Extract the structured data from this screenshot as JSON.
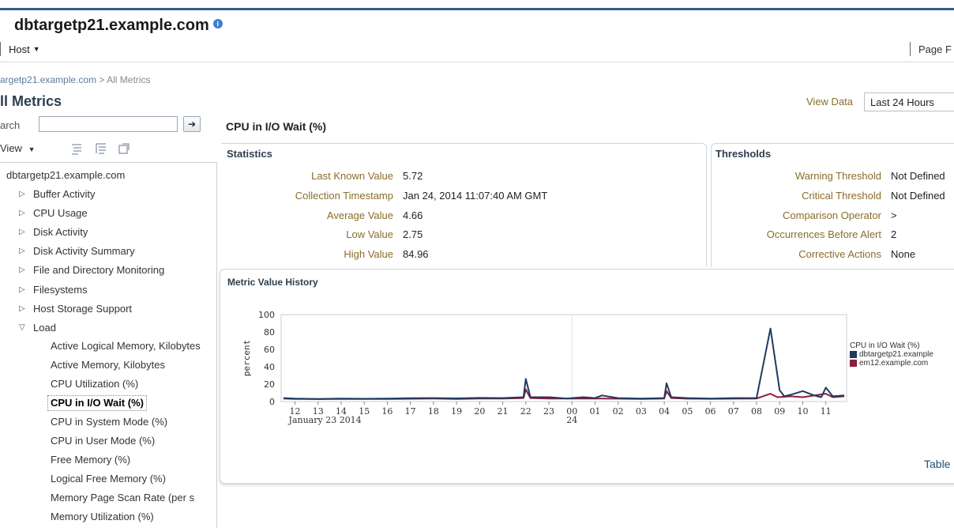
{
  "header": {
    "host_title": "dbtargetp21.example.com",
    "info_icon": "i",
    "host_menu": "Host",
    "page_menu_partial": "Page F"
  },
  "breadcrumb": {
    "host": "argetp21.example.com",
    "separator": ">",
    "current": "All Metrics"
  },
  "page_title": "ll Metrics",
  "search": {
    "label": "arch",
    "value": "",
    "go_icon": "➔"
  },
  "view_menu": {
    "label": "View"
  },
  "view_data": {
    "label": "View Data",
    "selected": "Last 24 Hours"
  },
  "tree": {
    "root": "dbtargetp21.example.com",
    "collapsed": [
      "Buffer Activity",
      "CPU Usage",
      "Disk Activity",
      "Disk Activity Summary",
      "File and Directory Monitoring",
      "Filesystems",
      "Host Storage Support"
    ],
    "expanded": "Load",
    "leaves": [
      "Active Logical Memory, Kilobytes",
      "Active Memory, Kilobytes",
      "CPU Utilization (%)",
      "CPU in I/O Wait (%)",
      "CPU in System Mode (%)",
      "CPU in User Mode (%)",
      "Free Memory (%)",
      "Logical Free Memory (%)",
      "Memory Page Scan Rate (per s",
      "Memory Utilization (%)"
    ],
    "selected_leaf": "CPU in I/O Wait (%)"
  },
  "metric_title": "CPU in I/O Wait (%)",
  "statistics": {
    "heading": "Statistics",
    "rows": [
      {
        "label": "Last Known Value",
        "value": "5.72"
      },
      {
        "label": "Collection Timestamp",
        "value": "Jan 24, 2014 11:07:40 AM GMT"
      },
      {
        "label": "Average Value",
        "value": "4.66"
      },
      {
        "label": "Low Value",
        "value": "2.75"
      },
      {
        "label": "High Value",
        "value": "84.96"
      }
    ]
  },
  "thresholds": {
    "heading": "Thresholds",
    "rows": [
      {
        "label": "Warning Threshold",
        "value": "Not Defined"
      },
      {
        "label": "Critical Threshold",
        "value": "Not Defined"
      },
      {
        "label": "Comparison Operator",
        "value": ">"
      },
      {
        "label": "Occurrences Before Alert",
        "value": "2"
      },
      {
        "label": "Corrective Actions",
        "value": "None"
      }
    ]
  },
  "history": {
    "heading": "Metric Value History",
    "table_link": "Table"
  },
  "chart_data": {
    "type": "line",
    "ylabel": "percent",
    "ylim": [
      0,
      100
    ],
    "yticks": [
      0,
      20,
      40,
      60,
      80,
      100
    ],
    "xticks": [
      "12",
      "13",
      "14",
      "15",
      "16",
      "17",
      "18",
      "19",
      "20",
      "21",
      "22",
      "23",
      "00",
      "01",
      "02",
      "03",
      "04",
      "05",
      "06",
      "07",
      "08",
      "09",
      "10",
      "11"
    ],
    "xsublabels": {
      "12": "January 23 2014",
      "00": "24"
    },
    "legend_title": "CPU in I/O Wait (%)",
    "grid": "vertical line at 00",
    "series": [
      {
        "name": "dbtargetp21.example",
        "color": "#1f3a5f",
        "x": [
          11.5,
          12,
          13,
          14,
          15,
          16,
          17,
          18,
          19,
          20,
          21,
          21.9,
          22,
          22.2,
          23,
          23.8,
          24,
          24.5,
          25,
          25.3,
          26,
          27,
          28,
          28.1,
          28.3,
          29,
          30,
          31,
          32,
          32.6,
          33,
          33.2,
          33.5,
          34,
          34.5,
          34.8,
          35,
          35.3,
          35.8
        ],
        "values": [
          4,
          3.5,
          3,
          3.5,
          3.2,
          3.5,
          3.8,
          4,
          3.6,
          4.2,
          4,
          5,
          26,
          5,
          5,
          3.5,
          4,
          5,
          4,
          7,
          4,
          3.5,
          4,
          21,
          5,
          4,
          3.5,
          4,
          4,
          84,
          13,
          6,
          8,
          12,
          7,
          5,
          16,
          6,
          7
        ]
      },
      {
        "name": "em12.example.com",
        "color": "#8b1e3f",
        "x": [
          11.5,
          12,
          13,
          14,
          15,
          16,
          17,
          18,
          19,
          20,
          21,
          21.9,
          22,
          22.2,
          23,
          24,
          25,
          26,
          27,
          28,
          28.1,
          28.3,
          29,
          30,
          31,
          32,
          32.6,
          32.9,
          33.5,
          34,
          35,
          35.3,
          35.8
        ],
        "values": [
          3.5,
          3,
          2.8,
          3,
          2.9,
          3,
          3.2,
          3.4,
          3,
          3.5,
          3.4,
          4,
          14,
          4,
          3.5,
          3.4,
          3.5,
          3.3,
          3,
          3.5,
          12,
          4,
          3.3,
          3.1,
          3.3,
          3.5,
          9,
          5,
          6,
          5,
          9,
          5,
          6
        ]
      }
    ]
  },
  "colors": {
    "accent": "#355b85",
    "label": "#8a6d2a",
    "series1": "#1f3a5f",
    "series2": "#8b1e3f"
  }
}
